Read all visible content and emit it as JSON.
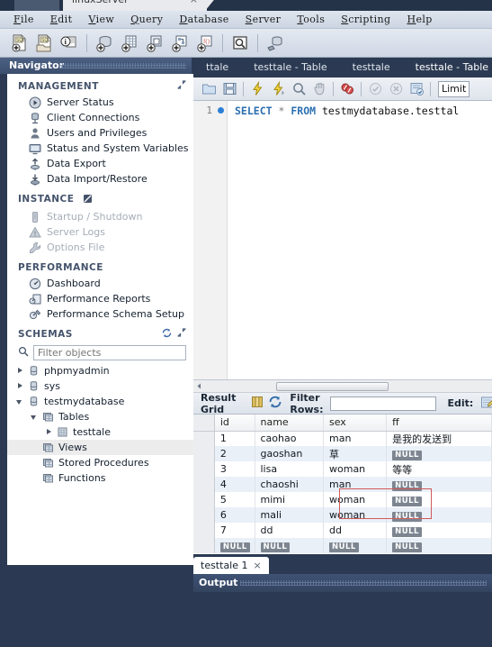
{
  "window": {
    "connection_tab": "linuxServer",
    "close_glyph": "×"
  },
  "menubar": {
    "items": [
      "File",
      "Edit",
      "View",
      "Query",
      "Database",
      "Server",
      "Tools",
      "Scripting",
      "Help"
    ]
  },
  "toolbar": {
    "buttons": [
      {
        "name": "new-sql-tab-icon",
        "title": "SQL"
      },
      {
        "name": "open-sql-script-icon",
        "title": "SQL"
      },
      {
        "name": "connection-info-icon",
        "title": "i"
      },
      {
        "name": "new-schema-icon",
        "title": ""
      },
      {
        "name": "new-table-icon",
        "title": ""
      },
      {
        "name": "new-view-icon",
        "title": ""
      },
      {
        "name": "new-procedure-icon",
        "title": ""
      },
      {
        "name": "new-function-icon",
        "title": ""
      },
      {
        "name": "search-data-icon",
        "title": ""
      },
      {
        "name": "reconnect-server-icon",
        "title": ""
      }
    ]
  },
  "navigator": {
    "title": "Navigator",
    "sections": [
      {
        "id": "management",
        "label": "MANAGEMENT",
        "expand_icon": "expand-icon",
        "items": [
          {
            "label": "Server Status",
            "icon": "server-status-icon",
            "disabled": false
          },
          {
            "label": "Client Connections",
            "icon": "client-connections-icon",
            "disabled": false
          },
          {
            "label": "Users and Privileges",
            "icon": "users-privileges-icon",
            "disabled": false
          },
          {
            "label": "Status and System Variables",
            "icon": "status-variables-icon",
            "disabled": false
          },
          {
            "label": "Data Export",
            "icon": "data-export-icon",
            "disabled": false
          },
          {
            "label": "Data Import/Restore",
            "icon": "data-import-icon",
            "disabled": false
          }
        ]
      },
      {
        "id": "instance",
        "label": "INSTANCE",
        "header_icon": "no-instance-icon",
        "items": [
          {
            "label": "Startup / Shutdown",
            "icon": "startup-shutdown-icon",
            "disabled": true
          },
          {
            "label": "Server Logs",
            "icon": "server-logs-icon",
            "disabled": true
          },
          {
            "label": "Options File",
            "icon": "options-file-icon",
            "disabled": true
          }
        ]
      },
      {
        "id": "performance",
        "label": "PERFORMANCE",
        "items": [
          {
            "label": "Dashboard",
            "icon": "dashboard-icon",
            "disabled": false
          },
          {
            "label": "Performance Reports",
            "icon": "performance-reports-icon",
            "disabled": false
          },
          {
            "label": "Performance Schema Setup",
            "icon": "performance-schema-icon",
            "disabled": false
          }
        ]
      }
    ],
    "schemas": {
      "label": "SCHEMAS",
      "refresh_icon": "refresh-icon",
      "expand_icon": "expand-icon",
      "filter_placeholder": "Filter objects",
      "filter_value": "",
      "search_icon": "search-icon",
      "tree": [
        {
          "label": "phpmyadmin",
          "icon": "schema-icon",
          "indent": 0,
          "state": "collapsed"
        },
        {
          "label": "sys",
          "icon": "schema-icon",
          "indent": 0,
          "state": "collapsed"
        },
        {
          "label": "testmydatabase",
          "icon": "schema-icon",
          "indent": 0,
          "state": "expanded"
        },
        {
          "label": "Tables",
          "icon": "folder-icon",
          "indent": 1,
          "state": "expanded"
        },
        {
          "label": "testtale",
          "icon": "table-icon",
          "indent": 2,
          "state": "collapsed"
        },
        {
          "label": "Views",
          "icon": "folder-icon",
          "indent": 1,
          "state": "none",
          "selected": true
        },
        {
          "label": "Stored Procedures",
          "icon": "folder-icon",
          "indent": 1,
          "state": "none"
        },
        {
          "label": "Functions",
          "icon": "folder-icon",
          "indent": 1,
          "state": "none"
        }
      ]
    }
  },
  "editor_tabs": [
    {
      "label": "ttale",
      "active": false
    },
    {
      "label": "testtale - Table",
      "active": false
    },
    {
      "label": "testtale",
      "active": false
    },
    {
      "label": "testtale - Table",
      "active": true
    }
  ],
  "sql_toolbar": {
    "buttons": [
      {
        "name": "open-script-icon"
      },
      {
        "name": "save-script-icon"
      },
      {
        "name": "execute-icon"
      },
      {
        "name": "execute-current-statement-icon"
      },
      {
        "name": "explain-icon"
      },
      {
        "name": "stop-icon"
      },
      {
        "name": "toggle-stop-on-error-icon"
      },
      {
        "name": "commit-icon"
      },
      {
        "name": "rollback-icon"
      },
      {
        "name": "toggle-autocommit-icon"
      }
    ],
    "limit_label": "Limit"
  },
  "editor": {
    "line_number": "1",
    "breakpoint_icon": "statement-marker-icon",
    "sql": {
      "keyword1": "SELECT",
      "star": "*",
      "keyword2": "FROM",
      "identifier": "testmydatabase.testtal"
    }
  },
  "grid_toolbar": {
    "title": "Result Grid",
    "grid_view_icon": "grid-view-icon",
    "refresh_icon": "refresh-grid-icon",
    "filter_label": "Filter Rows:",
    "filter_value": "",
    "filter_placeholder": "",
    "edit_label": "Edit:",
    "edit_icon": "edit-row-icon"
  },
  "result_grid": {
    "columns": [
      "id",
      "name",
      "sex",
      "ff"
    ],
    "rows": [
      {
        "id": "1",
        "name": "caohao",
        "sex": "man",
        "ff": "是我的发送到",
        "ff_null": false
      },
      {
        "id": "2",
        "name": "gaoshan",
        "sex": "草",
        "ff": "NULL",
        "ff_null": true
      },
      {
        "id": "3",
        "name": "lisa",
        "sex": "woman",
        "ff": "等等",
        "ff_null": false
      },
      {
        "id": "4",
        "name": "chaoshi",
        "sex": "man",
        "ff": "NULL",
        "ff_null": true
      },
      {
        "id": "5",
        "name": "mimi",
        "sex": "woman",
        "ff": "NULL",
        "ff_null": true
      },
      {
        "id": "6",
        "name": "mali",
        "sex": "woman",
        "ff": "NULL",
        "ff_null": true
      },
      {
        "id": "7",
        "name": "dd",
        "sex": "dd",
        "ff": "NULL",
        "ff_null": true
      }
    ],
    "new_row": {
      "id": "NULL",
      "name": "NULL",
      "sex": "NULL",
      "ff": "NULL"
    },
    "null_badge_text": "NULL",
    "highlight_color": "#d05a5a"
  },
  "bottom_tab": {
    "label": "testtale 1",
    "close_glyph": "×"
  },
  "output": {
    "label": "Output"
  },
  "colors": {
    "window_bg": "#2b3a52",
    "accent_blue": "#2b6fb0",
    "row_alt": "#eaf0f8",
    "null_badge": "#7c8590"
  }
}
